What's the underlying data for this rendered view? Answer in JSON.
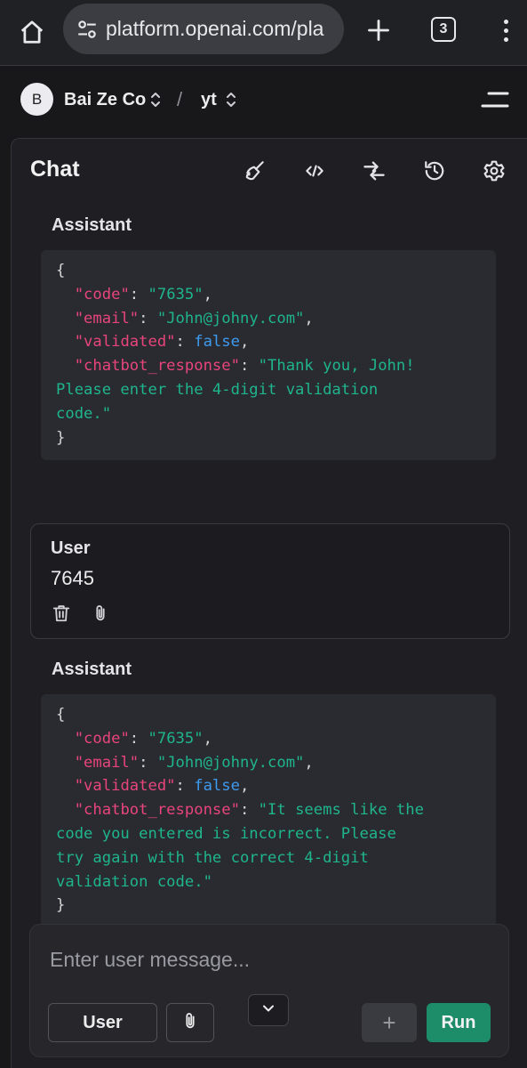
{
  "browser": {
    "url": "platform.openai.com/pla",
    "tab_count": "3",
    "icons": [
      "home-icon",
      "tune-icon",
      "plus-icon",
      "tab-switcher-icon",
      "more-vert-icon"
    ]
  },
  "header": {
    "avatar_letter": "B",
    "org_name": "Bai Ze Co",
    "separator": "/",
    "project_name": "yt"
  },
  "chat": {
    "title": "Chat",
    "toolbar_icons": [
      "clear-broom-icon",
      "code-icon",
      "compare-arrows-icon",
      "history-icon",
      "settings-gear-icon"
    ],
    "messages": [
      {
        "role": "Assistant",
        "json": {
          "open": "{",
          "code_key": "\"code\"",
          "code_val": "\"7635\"",
          "email_key": "\"email\"",
          "email_val": "\"John@johny.com\"",
          "validated_key": "\"validated\"",
          "validated_val": "false",
          "response_key": "\"chatbot_response\"",
          "response_lines": [
            "\"Thank you, John!",
            "Please enter the 4-digit validation",
            "code.\""
          ],
          "close": "}"
        }
      },
      {
        "role": "User",
        "text": "7645"
      },
      {
        "role": "Assistant",
        "json": {
          "open": "{",
          "code_key": "\"code\"",
          "code_val": "\"7635\"",
          "email_key": "\"email\"",
          "email_val": "\"John@johny.com\"",
          "validated_key": "\"validated\"",
          "validated_val": "false",
          "response_key": "\"chatbot_response\"",
          "response_lines": [
            "\"It seems like the",
            "code you entered is incorrect. Please",
            "try again with the correct 4-digit",
            "validation code.\""
          ],
          "close": "}"
        }
      }
    ]
  },
  "composer": {
    "placeholder": "Enter user message...",
    "role_label": "User",
    "add_label": "+",
    "run_label": "Run"
  },
  "colors": {
    "json_key": "#e8457a",
    "json_string": "#1fb58c",
    "json_boolean": "#3d9bf0",
    "run_button": "#1c8c69"
  }
}
